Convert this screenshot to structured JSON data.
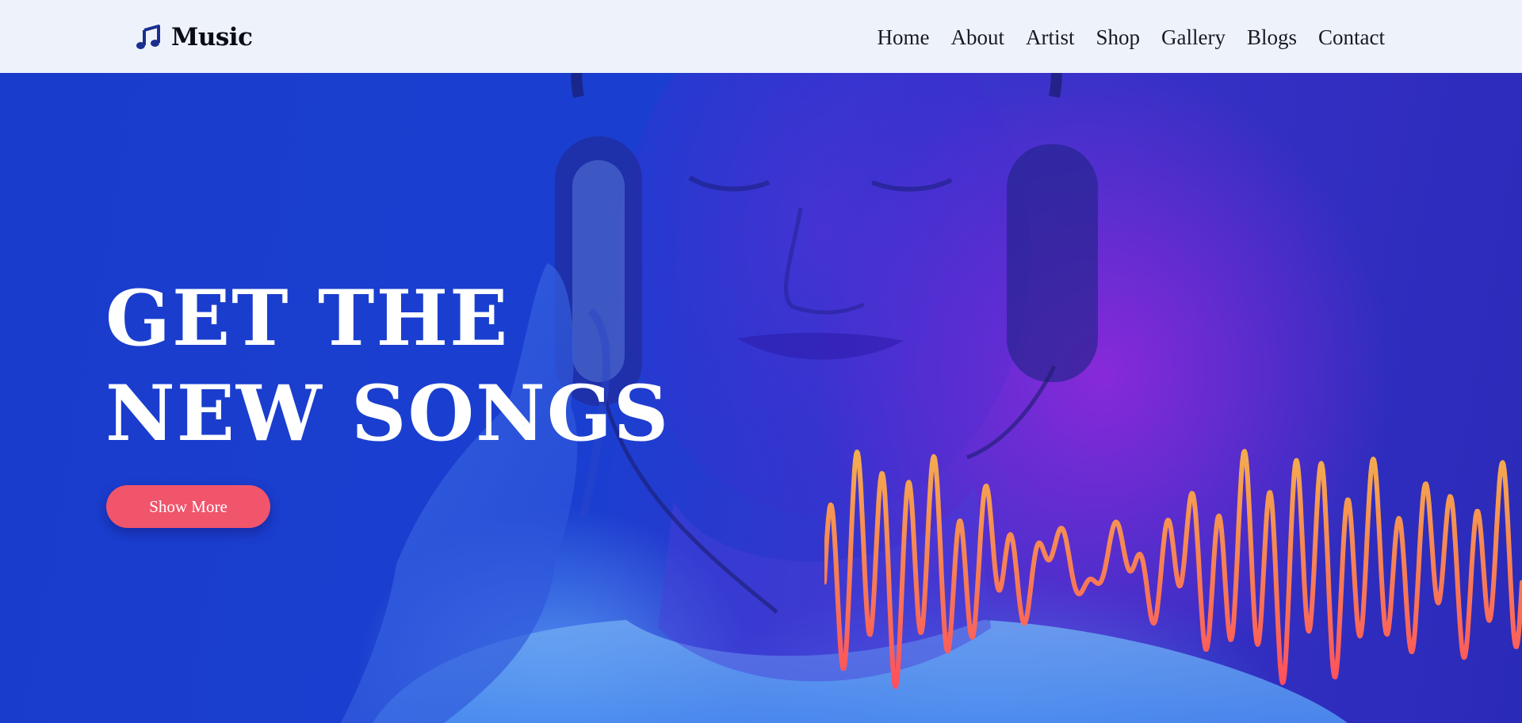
{
  "brand": {
    "name": "Music",
    "icon": "music-note-icon"
  },
  "nav": {
    "links": [
      "Home",
      "About",
      "Artist",
      "Shop",
      "Gallery",
      "Blogs",
      "Contact"
    ]
  },
  "hero": {
    "title_line1": "GET THE",
    "title_line2": "NEW SONGS",
    "button_label": "Show More"
  },
  "colors": {
    "nav_background": "#eef3fb",
    "hero_blue": "#1a3ccc",
    "hero_purple": "#8a24d8",
    "button": "#f0556b",
    "wave_top": "#f4a94e",
    "wave_bottom": "#ff5a5a"
  }
}
